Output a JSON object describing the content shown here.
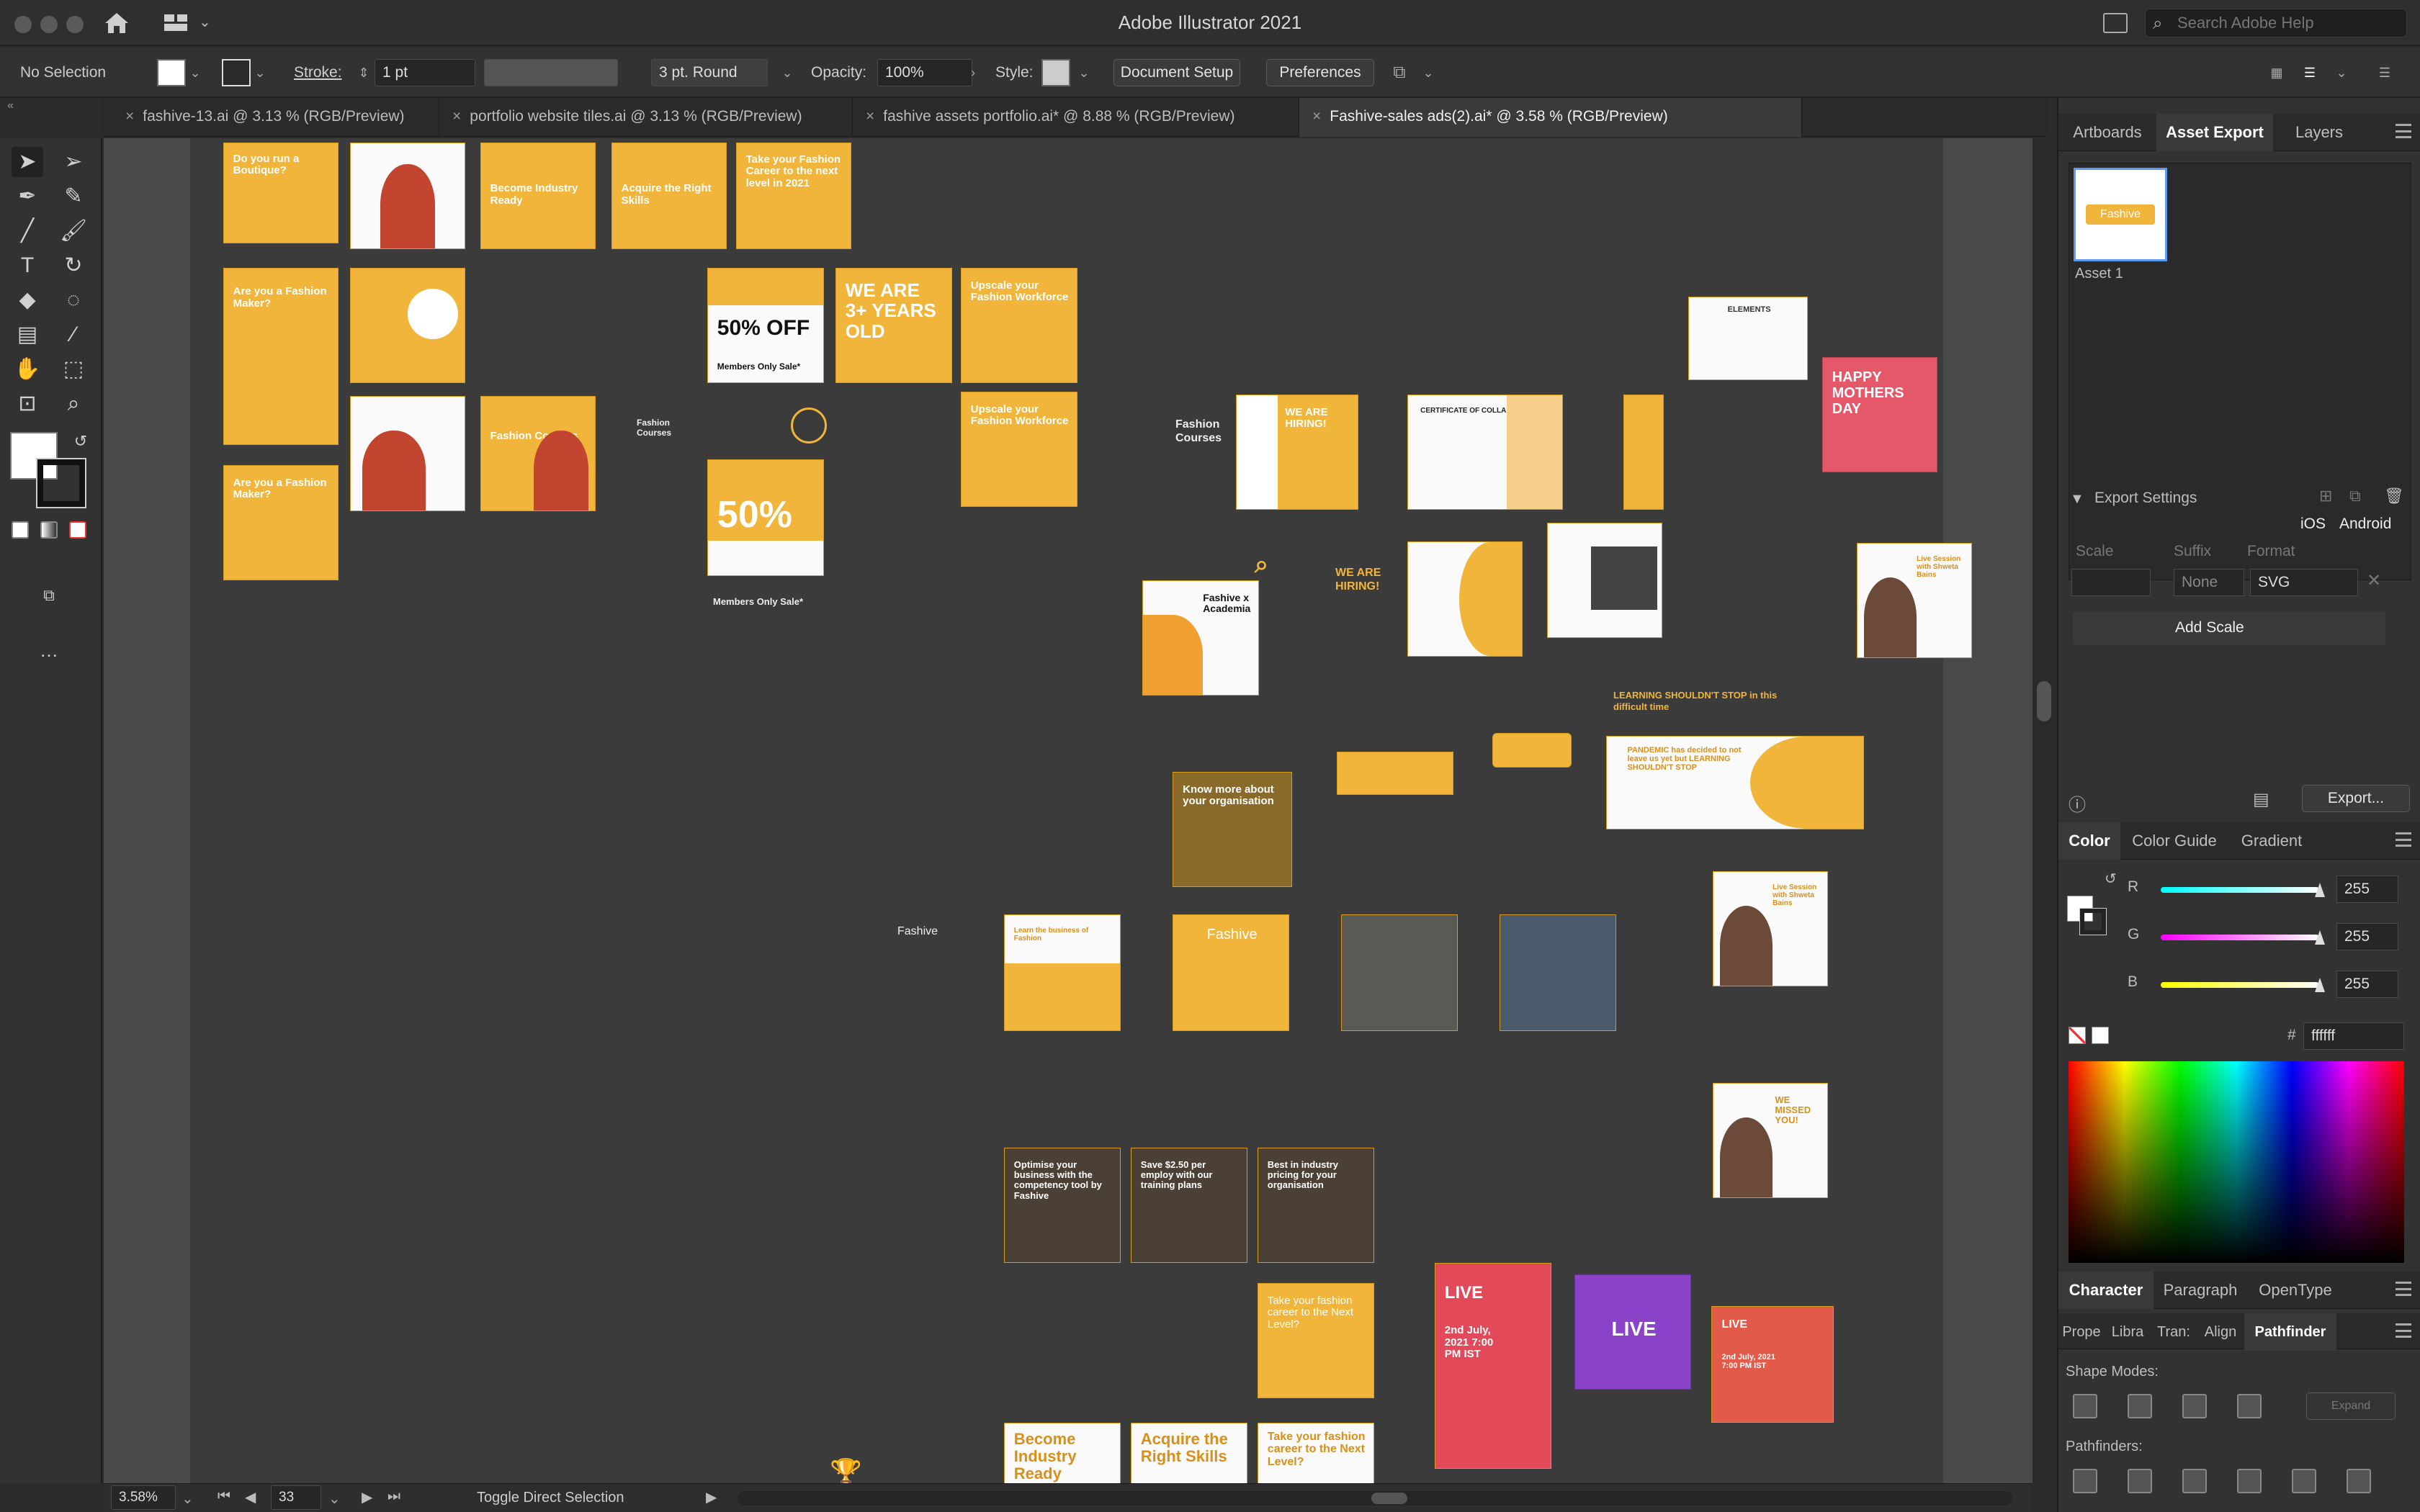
{
  "app": {
    "window_title": "Adobe Illustrator 2021"
  },
  "search": {
    "placeholder": "Search Adobe Help"
  },
  "control_bar": {
    "selection": "No Selection",
    "stroke_label": "Stroke:",
    "stroke_value": "1 pt",
    "brush": "3 pt. Round",
    "opacity_label": "Opacity:",
    "opacity_value": "100%",
    "style_label": "Style:",
    "document_setup": "Document Setup",
    "preferences": "Preferences"
  },
  "tabs": [
    {
      "label": "fashive-13.ai @ 3.13 % (RGB/Preview)",
      "active": false
    },
    {
      "label": "portfolio website tiles.ai @ 3.13 % (RGB/Preview)",
      "active": false
    },
    {
      "label": "fashive assets portfolio.ai* @ 8.88 % (RGB/Preview)",
      "active": false
    },
    {
      "label": "Fashive-sales ads(2).ai* @ 3.58 % (RGB/Preview)",
      "active": true
    }
  ],
  "artboard_texts": {
    "boutique": "Do you run a Boutique?",
    "industry_ready": "Become Industry Ready",
    "right_skills": "Acquire the Right Skills",
    "career": "Take your Fashion Career to the next level in 2021",
    "fashion_maker": "Are you a Fashion Maker?",
    "fashion_courses": "Fashion Courses",
    "fifty_off": "50% OFF",
    "members_only": "Members Only Sale*",
    "we_are": "WE ARE 3+ YEARS OLD",
    "upscale": "Upscale your Fashion Workforce",
    "fifty": "50%",
    "hiring": "WE ARE HIRING!",
    "certificate": "CERTIFICATE OF COLLABORATION",
    "elements": "ELEMENTS",
    "mothers_day": "HAPPY MOTHERS DAY",
    "academia": "Fashive x Academia",
    "learning": "LEARNING SHOULDN'T STOP in this difficult time",
    "pandemic": "PANDEMIC has decided to not leave us yet but LEARNING SHOULDN'T STOP",
    "know_more": "Know more about your organisation",
    "fashive": "Fashive",
    "fashive_tag": "Learn the business of Fashion",
    "live_session": "Live Session with Shweta Bains",
    "missed": "WE MISSED YOU!",
    "optimise": "Optimise your business with the competency tool by Fashive",
    "save": "Save $2.50 per employ with our training plans",
    "best": "Best in industry pricing for your organisation",
    "next_level": "Take your fashion career to the Next Level?",
    "live": "LIVE",
    "live_date": "2nd July, 2021 7:00 PM IST"
  },
  "statusbar": {
    "zoom": "3.58%",
    "page": "33",
    "tool_hint": "Toggle Direct Selection"
  },
  "panels": {
    "top_tabs": [
      "Artboards",
      "Asset Export",
      "Layers"
    ],
    "asset_name": "Asset 1",
    "asset_thumb": "Fashive",
    "export_settings": "Export Settings",
    "ios": "iOS",
    "android": "Android",
    "scale": "Scale",
    "suffix": "Suffix",
    "format": "Format",
    "suffix_value": "None",
    "format_value": "SVG",
    "add_scale": "Add Scale",
    "export_btn": "Export...",
    "color_tabs": [
      "Color",
      "Color Guide",
      "Gradient"
    ],
    "r": "R",
    "g": "G",
    "b": "B",
    "r_val": "255",
    "g_val": "255",
    "b_val": "255",
    "hex_label": "#",
    "hex_val": "ffffff",
    "char_tabs": [
      "Character",
      "Paragraph",
      "OpenType"
    ],
    "sub_tabs": [
      "Prope",
      "Libra",
      "Tran:",
      "Align",
      "Pathfinder"
    ],
    "shape_modes": "Shape Modes:",
    "expand": "Expand",
    "pathfinders": "Pathfinders:"
  }
}
